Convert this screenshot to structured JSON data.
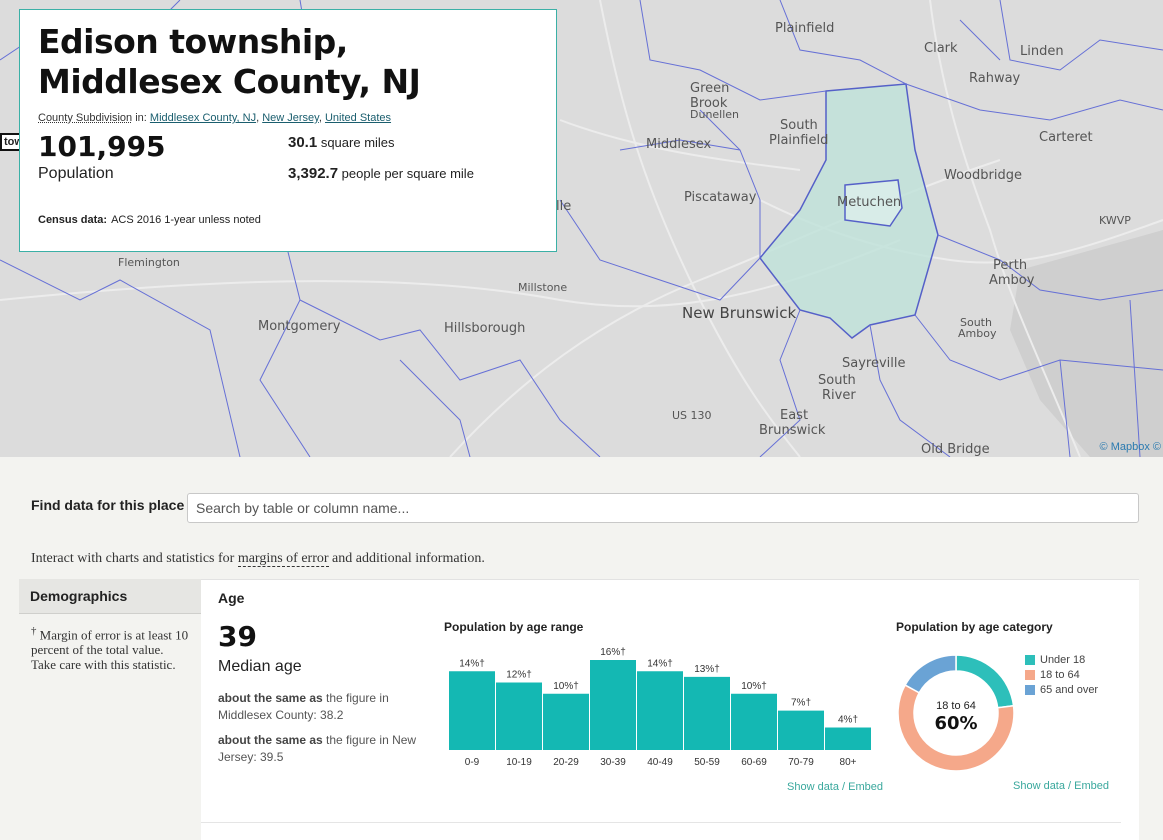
{
  "map": {
    "labels": [
      {
        "text": "Plainfield",
        "size": "md"
      },
      {
        "text": "Clark",
        "size": "md"
      },
      {
        "text": "Linden",
        "size": "md"
      },
      {
        "text": "Rahway",
        "size": "md"
      },
      {
        "text": "Green",
        "size": "md"
      },
      {
        "text": "Brook",
        "size": "md"
      },
      {
        "text": "Dunellen",
        "size": "sm"
      },
      {
        "text": "South",
        "size": "md"
      },
      {
        "text": "Plainfield",
        "size": "md"
      },
      {
        "text": "Middlesex",
        "size": "md"
      },
      {
        "text": "Carteret",
        "size": "md"
      },
      {
        "text": "Woodbridge",
        "size": "md"
      },
      {
        "text": "Piscataway",
        "size": "md"
      },
      {
        "text": "Metuchen",
        "size": "md"
      },
      {
        "text": "lle",
        "size": "md"
      },
      {
        "text": "KWVP",
        "size": "sm"
      },
      {
        "text": "Flemington",
        "size": "sm"
      },
      {
        "text": "Perth",
        "size": "md"
      },
      {
        "text": "Amboy",
        "size": "md"
      },
      {
        "text": "Millstone",
        "size": "sm"
      },
      {
        "text": "Montgomery",
        "size": "md"
      },
      {
        "text": "Hillsborough",
        "size": "md"
      },
      {
        "text": "New Brunswick",
        "size": "lg"
      },
      {
        "text": "South",
        "size": "sm"
      },
      {
        "text": "Amboy",
        "size": "sm"
      },
      {
        "text": "Sayreville",
        "size": "md"
      },
      {
        "text": "South",
        "size": "md"
      },
      {
        "text": "River",
        "size": "md"
      },
      {
        "text": "US 130",
        "size": "sm"
      },
      {
        "text": "East",
        "size": "md"
      },
      {
        "text": "Brunswick",
        "size": "md"
      },
      {
        "text": "Old Bridge",
        "size": "md"
      }
    ],
    "attribution": "© Mapbox ©",
    "cut_label": "tow"
  },
  "header": {
    "title": "Edison township, Middlesex County, NJ",
    "sumlev_label": "County Subdivision",
    "sumlev_in": " in: ",
    "parents": [
      "Middlesex County, NJ",
      "New Jersey",
      "United States"
    ],
    "population_value": "101,995",
    "population_label": "Population",
    "area_value": "30.1",
    "area_label": "square miles",
    "density_value": "3,392.7",
    "density_label": "people per square mile",
    "census_label": "Census data:",
    "census_value": "ACS 2016 1-year unless noted"
  },
  "find": {
    "label": "Find data for this place",
    "placeholder": "Search by table or column name..."
  },
  "interact": {
    "before": "Interact with charts and statistics for ",
    "link": "margins of error",
    "after": " and additional information."
  },
  "sidebar": {
    "title": "Demographics",
    "note_mark": "†",
    "note": " Margin of error is at least 10 percent of the total value. Take care with this statistic."
  },
  "age": {
    "heading": "Age",
    "median_value": "39",
    "median_label": "Median age",
    "comparisons": [
      {
        "bold": "about the same as",
        "rest": " the figure in Middlesex County: 38.2"
      },
      {
        "bold": "about the same as",
        "rest": " the figure in New Jersey: 39.5"
      }
    ]
  },
  "links": {
    "show": "Show data",
    "sep": " / ",
    "embed": "Embed"
  },
  "chart_data": [
    {
      "type": "bar",
      "title": "Population by age range",
      "categories": [
        "0-9",
        "10-19",
        "20-29",
        "30-39",
        "40-49",
        "50-59",
        "60-69",
        "70-79",
        "80+"
      ],
      "values": [
        14,
        12,
        10,
        16,
        14,
        13,
        10,
        7,
        4
      ],
      "value_labels": [
        "14%†",
        "12%†",
        "10%†",
        "16%†",
        "14%†",
        "13%†",
        "10%†",
        "7%†",
        "4%†"
      ],
      "color": "#14b8b3"
    },
    {
      "type": "pie",
      "title": "Population by age category",
      "categories": [
        "Under 18",
        "18 to 64",
        "65 and over"
      ],
      "values": [
        23,
        60,
        17
      ],
      "colors": [
        "#2dbfba",
        "#f5a88a",
        "#6aa3d5"
      ],
      "center_label": "18 to 64",
      "center_value": "60%"
    }
  ]
}
